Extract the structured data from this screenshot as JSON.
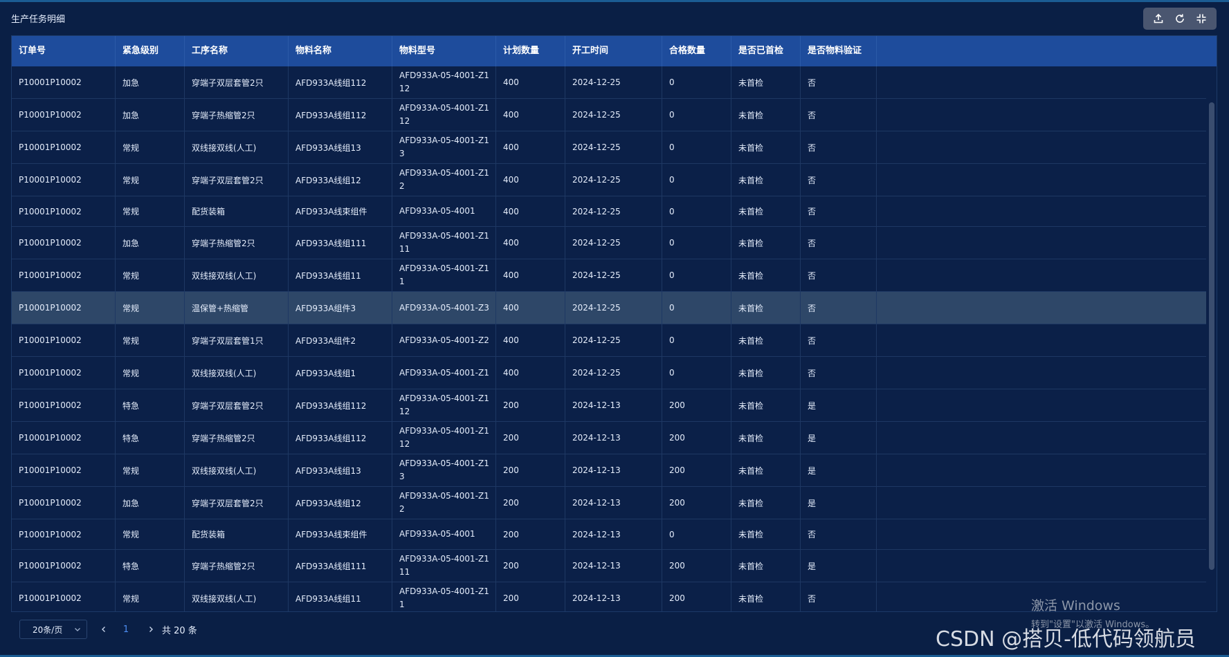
{
  "panel": {
    "title": "生产任务明细"
  },
  "toolbar": {
    "export_icon": "upload-icon",
    "refresh_icon": "refresh-icon",
    "collapse_icon": "fullscreen-exit-icon"
  },
  "table": {
    "columns": [
      "订单号",
      "紧急级别",
      "工序名称",
      "物料名称",
      "物料型号",
      "计划数量",
      "开工时间",
      "合格数量",
      "是否已首检",
      "是否物料验证",
      ""
    ],
    "rows": [
      [
        "P10001P10002",
        "加急",
        "穿端子双层套管2只",
        "AFD933A线组112",
        "AFD933A-05-4001-Z112",
        "400",
        "2024-12-25",
        "0",
        "未首检",
        "否"
      ],
      [
        "P10001P10002",
        "加急",
        "穿端子热缩管2只",
        "AFD933A线组112",
        "AFD933A-05-4001-Z112",
        "400",
        "2024-12-25",
        "0",
        "未首检",
        "否"
      ],
      [
        "P10001P10002",
        "常规",
        "双线接双线(人工)",
        "AFD933A线组13",
        "AFD933A-05-4001-Z13",
        "400",
        "2024-12-25",
        "0",
        "未首检",
        "否"
      ],
      [
        "P10001P10002",
        "常规",
        "穿端子双层套管2只",
        "AFD933A线组12",
        "AFD933A-05-4001-Z12",
        "400",
        "2024-12-25",
        "0",
        "未首检",
        "否"
      ],
      [
        "P10001P10002",
        "常规",
        "配货装箱",
        "AFD933A线束组件",
        "AFD933A-05-4001",
        "400",
        "2024-12-25",
        "0",
        "未首检",
        "否"
      ],
      [
        "P10001P10002",
        "加急",
        "穿端子热缩管2只",
        "AFD933A线组111",
        "AFD933A-05-4001-Z111",
        "400",
        "2024-12-25",
        "0",
        "未首检",
        "否"
      ],
      [
        "P10001P10002",
        "常规",
        "双线接双线(人工)",
        "AFD933A线组11",
        "AFD933A-05-4001-Z11",
        "400",
        "2024-12-25",
        "0",
        "未首检",
        "否"
      ],
      [
        "P10001P10002",
        "常规",
        "温保管+热缩管",
        "AFD933A组件3",
        "AFD933A-05-4001-Z3",
        "400",
        "2024-12-25",
        "0",
        "未首检",
        "否"
      ],
      [
        "P10001P10002",
        "常规",
        "穿端子双层套管1只",
        "AFD933A组件2",
        "AFD933A-05-4001-Z2",
        "400",
        "2024-12-25",
        "0",
        "未首检",
        "否"
      ],
      [
        "P10001P10002",
        "常规",
        "双线接双线(人工)",
        "AFD933A线组1",
        "AFD933A-05-4001-Z1",
        "400",
        "2024-12-25",
        "0",
        "未首检",
        "否"
      ],
      [
        "P10001P10002",
        "特急",
        "穿端子双层套管2只",
        "AFD933A线组112",
        "AFD933A-05-4001-Z112",
        "200",
        "2024-12-13",
        "200",
        "未首检",
        "是"
      ],
      [
        "P10001P10002",
        "特急",
        "穿端子热缩管2只",
        "AFD933A线组112",
        "AFD933A-05-4001-Z112",
        "200",
        "2024-12-13",
        "200",
        "未首检",
        "是"
      ],
      [
        "P10001P10002",
        "常规",
        "双线接双线(人工)",
        "AFD933A线组13",
        "AFD933A-05-4001-Z13",
        "200",
        "2024-12-13",
        "200",
        "未首检",
        "是"
      ],
      [
        "P10001P10002",
        "加急",
        "穿端子双层套管2只",
        "AFD933A线组12",
        "AFD933A-05-4001-Z12",
        "200",
        "2024-12-13",
        "200",
        "未首检",
        "是"
      ],
      [
        "P10001P10002",
        "常规",
        "配货装箱",
        "AFD933A线束组件",
        "AFD933A-05-4001",
        "200",
        "2024-12-13",
        "0",
        "未首检",
        "否"
      ],
      [
        "P10001P10002",
        "特急",
        "穿端子热缩管2只",
        "AFD933A线组111",
        "AFD933A-05-4001-Z111",
        "200",
        "2024-12-13",
        "200",
        "未首检",
        "是"
      ],
      [
        "P10001P10002",
        "常规",
        "双线接双线(人工)",
        "AFD933A线组11",
        "AFD933A-05-4001-Z11",
        "200",
        "2024-12-13",
        "200",
        "未首检",
        "否"
      ]
    ],
    "selected_row": 7
  },
  "pagination": {
    "page_size": "20条/页",
    "current_page": "1",
    "total": "共 20 条"
  },
  "watermarks": {
    "windows_line1": "激活 Windows",
    "windows_line2": "转到\"设置\"以激活 Windows。",
    "csdn": "CSDN @搭贝-低代码领航员"
  },
  "colors": {
    "background": "#0a1f45",
    "header": "#1e4c9c",
    "selected_row": "#2e4768",
    "accent": "#4d8ef2"
  }
}
